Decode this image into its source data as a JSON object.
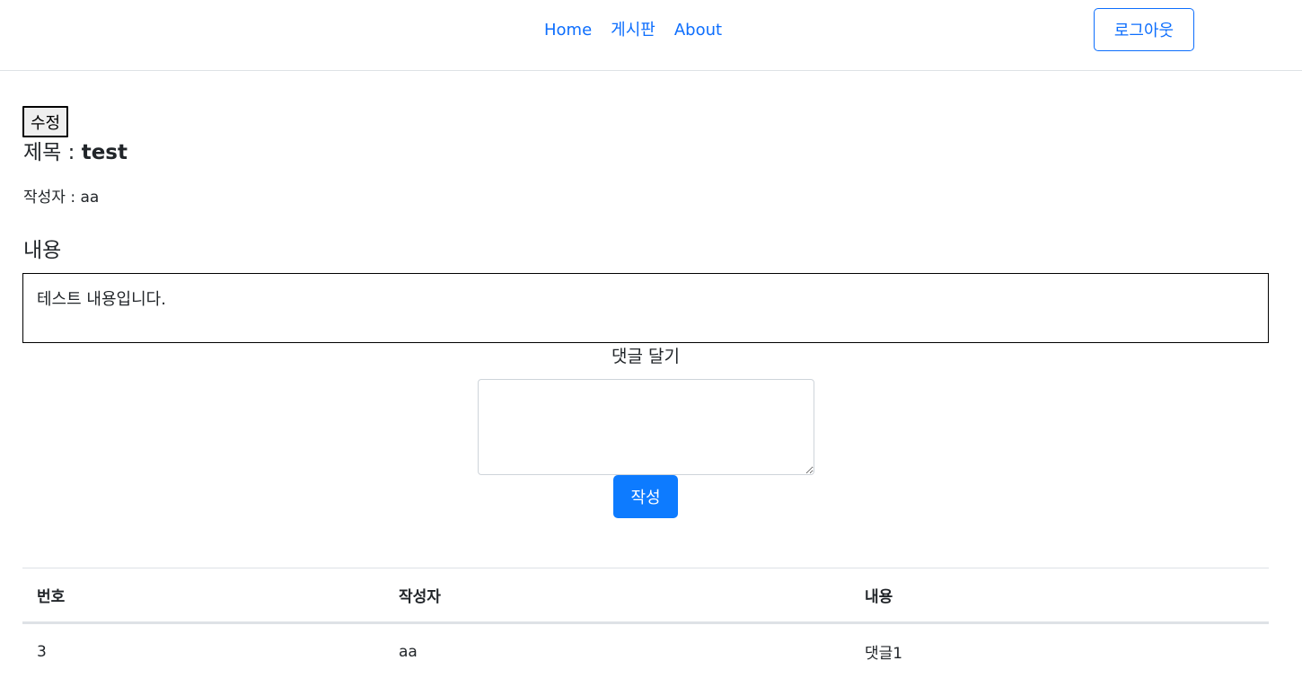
{
  "nav": {
    "items": [
      {
        "label": "Home"
      },
      {
        "label": "게시판"
      },
      {
        "label": "About"
      }
    ],
    "logout_label": "로그아웃"
  },
  "post": {
    "edit_label": "수정",
    "title_prefix": "제목 : ",
    "title": "test",
    "author_label": "작성자 : aa",
    "content_heading": "내용",
    "content": "테스트 내용입니다."
  },
  "comment_form": {
    "label": "댓글 달기",
    "input_value": "",
    "submit_label": "작성"
  },
  "comments": {
    "columns": [
      "번호",
      "작성자",
      "내용"
    ],
    "rows": [
      {
        "no": "3",
        "author": "aa",
        "content": "댓글1"
      }
    ]
  },
  "colors": {
    "link": "#0d6efd",
    "primary_button": "#0d7bff",
    "border": "#dee2e6"
  }
}
